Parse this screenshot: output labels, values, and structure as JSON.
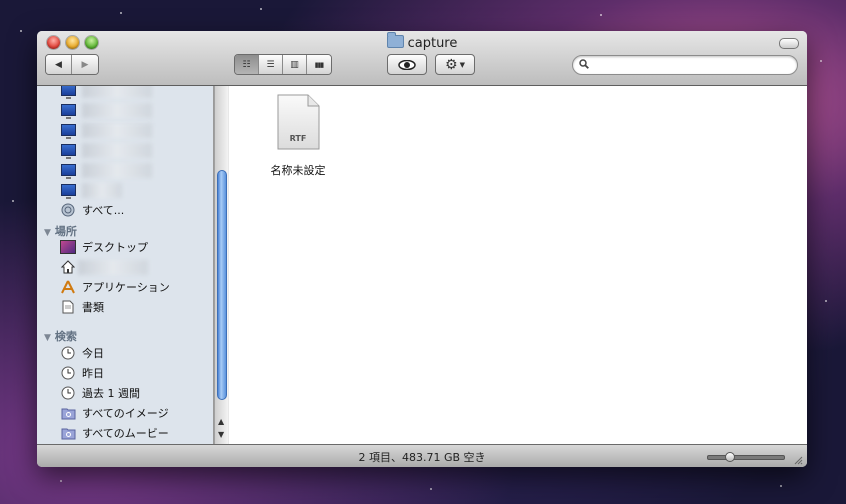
{
  "window": {
    "title": "capture"
  },
  "toolbar": {
    "view_modes": [
      {
        "name": "icon-view",
        "glyph": "☷",
        "active": true
      },
      {
        "name": "list-view",
        "glyph": "☰",
        "active": false
      },
      {
        "name": "column-view",
        "glyph": "▥",
        "active": false
      },
      {
        "name": "coverflow-view",
        "glyph": "▮▮▮",
        "active": false
      }
    ],
    "search": {
      "value": "",
      "placeholder": ""
    }
  },
  "sidebar": {
    "devices": [
      {
        "icon": "monitor-icon"
      },
      {
        "icon": "monitor-icon"
      },
      {
        "icon": "monitor-icon"
      },
      {
        "icon": "monitor-icon"
      },
      {
        "icon": "monitor-icon"
      },
      {
        "icon": "monitor-icon"
      }
    ],
    "all_label": "すべて...",
    "places_header": "場所",
    "places": [
      {
        "label": "デスクトップ",
        "icon": "desktop-icon"
      },
      {
        "label": "",
        "icon": "home-icon"
      },
      {
        "label": "アプリケーション",
        "icon": "applications-icon"
      },
      {
        "label": "書類",
        "icon": "documents-icon"
      }
    ],
    "search_header": "検索",
    "searches": [
      {
        "label": "今日",
        "icon": "clock-icon"
      },
      {
        "label": "昨日",
        "icon": "clock-icon"
      },
      {
        "label": "過去 1 週間",
        "icon": "clock-icon"
      },
      {
        "label": "すべてのイメージ",
        "icon": "smart-folder-icon"
      },
      {
        "label": "すべてのムービー",
        "icon": "smart-folder-icon"
      }
    ]
  },
  "content": {
    "files": [
      {
        "name": "名称未設定",
        "badge": "RTF",
        "icon": "rtf-document-icon"
      }
    ]
  },
  "status": {
    "text": "2 項目、483.71 GB 空き",
    "zoom_level": 0.25
  },
  "colors": {
    "sidebar_bg": "#dde4ec",
    "scroll_thumb": "#6aa1e6",
    "header_text": "#637283"
  }
}
